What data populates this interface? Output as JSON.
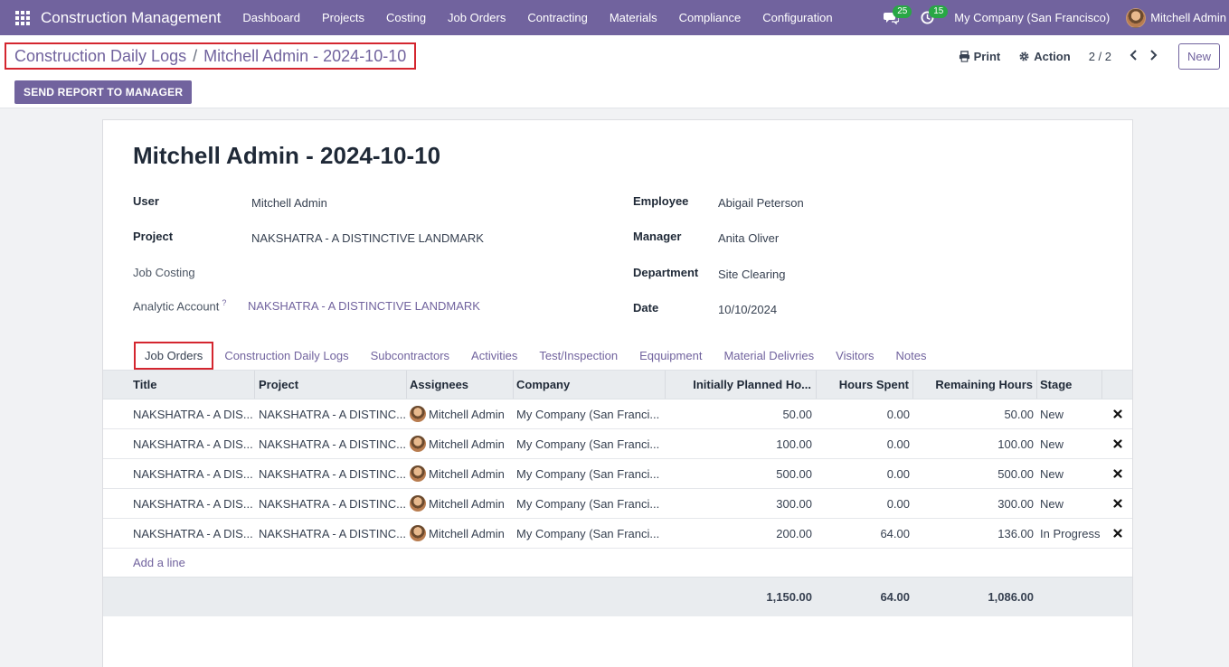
{
  "navbar": {
    "app_title": "Construction Management",
    "menu": [
      "Dashboard",
      "Projects",
      "Costing",
      "Job Orders",
      "Contracting",
      "Materials",
      "Compliance",
      "Configuration"
    ],
    "messages_count": "25",
    "activities_count": "15",
    "company": "My Company (San Francisco)",
    "user": "Mitchell Admin"
  },
  "control_panel": {
    "breadcrumb_parent": "Construction Daily Logs",
    "breadcrumb_separator": "/",
    "breadcrumb_current": "Mitchell Admin - 2024-10-10",
    "print_label": "Print",
    "action_label": "Action",
    "pager_value": "2 / 2",
    "new_label": "New",
    "send_report_label": "SEND REPORT TO MANAGER"
  },
  "form": {
    "title": "Mitchell Admin - 2024-10-10",
    "left_fields": {
      "user_label": "User",
      "user_value": "Mitchell Admin",
      "project_label": "Project",
      "project_value": "NAKSHATRA - A DISTINCTIVE LANDMARK",
      "job_costing_label": "Job Costing",
      "job_costing_value": "",
      "analytic_label": "Analytic Account",
      "analytic_help": "?",
      "analytic_value": "NAKSHATRA - A DISTINCTIVE LANDMARK"
    },
    "right_fields": {
      "employee_label": "Employee",
      "employee_value": "Abigail Peterson",
      "manager_label": "Manager",
      "manager_value": "Anita Oliver",
      "department_label": "Department",
      "department_value": "Site Clearing",
      "date_label": "Date",
      "date_value": "10/10/2024"
    }
  },
  "tabs": [
    "Job Orders",
    "Construction Daily Logs",
    "Subcontractors",
    "Activities",
    "Test/Inspection",
    "Eqquipment",
    "Material Delivries",
    "Visitors",
    "Notes"
  ],
  "active_tab": "Job Orders",
  "table": {
    "headers": [
      "Title",
      "Project",
      "Assignees",
      "Company",
      "Initially Planned Ho...",
      "Hours Spent",
      "Remaining Hours",
      "Stage"
    ],
    "rows": [
      {
        "title": "NAKSHATRA - A DIS...",
        "project": "NAKSHATRA - A DISTINC...",
        "assignee": "Mitchell Admin",
        "company": "My Company (San Franci...",
        "planned": "50.00",
        "spent": "0.00",
        "remaining": "50.00",
        "stage": "New"
      },
      {
        "title": "NAKSHATRA - A DIS...",
        "project": "NAKSHATRA - A DISTINC...",
        "assignee": "Mitchell Admin",
        "company": "My Company (San Franci...",
        "planned": "100.00",
        "spent": "0.00",
        "remaining": "100.00",
        "stage": "New"
      },
      {
        "title": "NAKSHATRA - A DIS...",
        "project": "NAKSHATRA - A DISTINC...",
        "assignee": "Mitchell Admin",
        "company": "My Company (San Franci...",
        "planned": "500.00",
        "spent": "0.00",
        "remaining": "500.00",
        "stage": "New"
      },
      {
        "title": "NAKSHATRA - A DIS...",
        "project": "NAKSHATRA - A DISTINC...",
        "assignee": "Mitchell Admin",
        "company": "My Company (San Franci...",
        "planned": "300.00",
        "spent": "0.00",
        "remaining": "300.00",
        "stage": "New"
      },
      {
        "title": "NAKSHATRA - A DIS...",
        "project": "NAKSHATRA - A DISTINC...",
        "assignee": "Mitchell Admin",
        "company": "My Company (San Franci...",
        "planned": "200.00",
        "spent": "64.00",
        "remaining": "136.00",
        "stage": "In Progress"
      }
    ],
    "add_line_label": "Add a line",
    "totals": {
      "planned": "1,150.00",
      "spent": "64.00",
      "remaining": "1,086.00"
    }
  },
  "colors": {
    "brand": "#71639e",
    "highlight_border": "#d4262f",
    "badge": "#28a745"
  }
}
